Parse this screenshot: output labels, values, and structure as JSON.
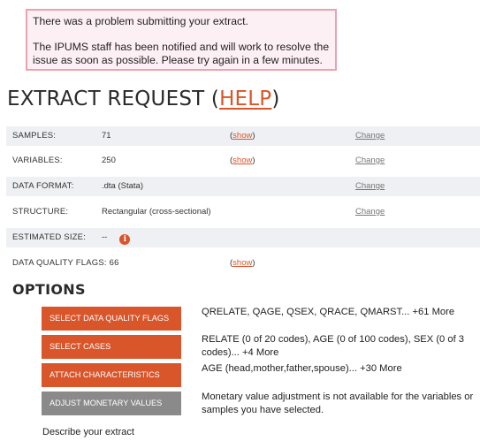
{
  "alert": {
    "line1": "There was a problem submitting your extract.",
    "line2": "The IPUMS staff has been notified and will work to resolve the issue as soon as possible. Please try again in a few minutes."
  },
  "title": {
    "prefix": "EXTRACT REQUEST (",
    "help": "HELP",
    "suffix": ")"
  },
  "request_rows": [
    {
      "label": "SAMPLES:",
      "value": "71",
      "show_open": "(",
      "show": "show",
      "show_close": ")",
      "change": "Change"
    },
    {
      "label": "VARIABLES:",
      "value": "250",
      "show_open": "(",
      "show": "show",
      "show_close": ")",
      "change": "Change"
    },
    {
      "label": "DATA FORMAT:",
      "value": ".dta (Stata)",
      "change": "Change"
    },
    {
      "label": "STRUCTURE:",
      "value": "Rectangular (cross-sectional)",
      "change": "Change"
    },
    {
      "label": "ESTIMATED SIZE:",
      "value": "--",
      "icon": "info-icon"
    },
    {
      "label": "DATA QUALITY FLAGS:",
      "value": "66",
      "show_open": "(",
      "show": "show",
      "show_close": ")"
    }
  ],
  "options": {
    "heading": "OPTIONS",
    "items": [
      {
        "button": "SELECT DATA QUALITY FLAGS",
        "description": "QRELATE, QAGE, QSEX, QRACE, QMARST... +61 More"
      },
      {
        "button": "SELECT CASES",
        "description": "RELATE (0 of 20 codes), AGE (0 of 100 codes), SEX (0 of 3 codes)... +4 More"
      },
      {
        "button": "ATTACH CHARACTERISTICS",
        "description": "AGE (head,mother,father,spouse)... +30 More"
      },
      {
        "button": "ADJUST MONETARY VALUES",
        "description": "Monetary value adjustment is not available for the variables or samples you have selected."
      }
    ]
  },
  "describe_label": "Describe your extract",
  "colors": {
    "accent": "#d9552a",
    "disabled": "#8a8a8a",
    "alert_border": "#e8a3ae",
    "alert_bg": "#fdf0f5",
    "row_shade": "#eef0f3"
  }
}
